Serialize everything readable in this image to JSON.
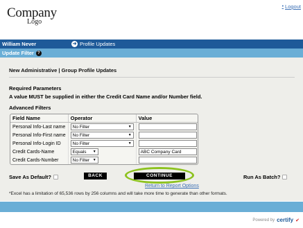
{
  "header": {
    "logo_main": "Company",
    "logo_sub": "Logo",
    "logout_label": "Logout"
  },
  "topbar": {
    "user_name": "William Never",
    "profile_link": "Profile Updates"
  },
  "subbar": {
    "title": "Update Filter",
    "help_icon_text": "?"
  },
  "content": {
    "section_title": "New Administrative | Group Profile Updates",
    "required_title": "Required Parameters",
    "required_message": "A value MUST be supplied in either the Credit Card Name and/or Number field.",
    "advanced_title": "Advanced Filters",
    "table": {
      "headers": [
        "Field Name",
        "Operator",
        "Value"
      ],
      "rows": [
        {
          "field": "Personal Info-Last name",
          "operator": "No Filter",
          "value": ""
        },
        {
          "field": "Personal Info-First name",
          "operator": "No Filter",
          "value": ""
        },
        {
          "field": "Personal Info-Login ID",
          "operator": "No Filter",
          "value": ""
        },
        {
          "field": "Credit Cards-Name",
          "operator": "Equals",
          "value": "ABC Company Card"
        },
        {
          "field": "Credit Cards-Number",
          "operator": "No Filter",
          "value": ""
        }
      ]
    },
    "save_default_label": "Save As Default?",
    "back_label": "BACK",
    "continue_label": "CONTINUE",
    "return_link": "Return to Report Options",
    "run_batch_label": "Run As Batch?",
    "note": "*Excel has a limitation of 65,536 rows by 256 columns and will take more time to generate than other formats."
  },
  "footer": {
    "powered_by": "Powered by",
    "brand": "certify"
  },
  "colors": {
    "topbar": "#1e5a99",
    "subbar": "#6aaed6",
    "content_bg": "#eeeeea",
    "highlight_ring": "#8dc21f",
    "link": "#3a6fb5"
  }
}
